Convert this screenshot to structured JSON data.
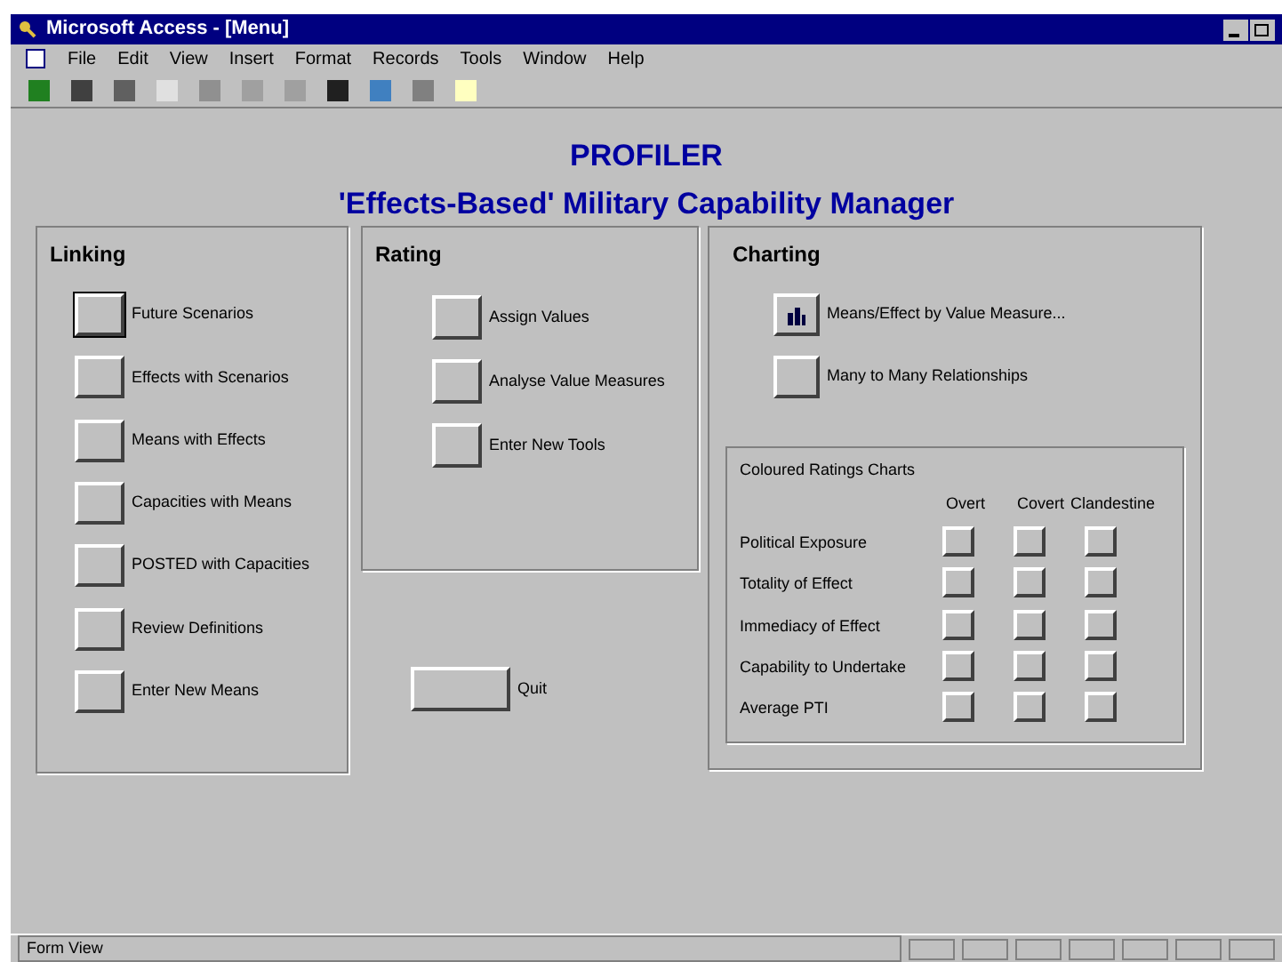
{
  "window": {
    "title": "Microsoft Access - [Menu]"
  },
  "menu": [
    "File",
    "Edit",
    "View",
    "Insert",
    "Format",
    "Records",
    "Tools",
    "Window",
    "Help"
  ],
  "form": {
    "title": "PROFILER",
    "subtitle": "'Effects-Based' Military Capability Manager"
  },
  "linking": {
    "title": "Linking",
    "buttons": [
      {
        "label": "Future Scenarios",
        "focused": true
      },
      {
        "label": "Effects with Scenarios",
        "focused": false
      },
      {
        "label": "Means with Effects",
        "focused": false
      },
      {
        "label": "Capacities with Means",
        "focused": false
      },
      {
        "label": "POSTED with Capacities",
        "focused": false
      },
      {
        "label": "Review Definitions",
        "focused": false
      },
      {
        "label": "Enter New Means",
        "focused": false
      }
    ]
  },
  "rating": {
    "title": "Rating",
    "buttons": [
      {
        "label": "Assign Values"
      },
      {
        "label": "Analyse Value Measures"
      },
      {
        "label": "Enter New Tools"
      }
    ]
  },
  "quit": {
    "label": "Quit"
  },
  "charting": {
    "title": "Charting",
    "buttons": [
      {
        "label": "Means/Effect by Value Measure...",
        "kind": "chart"
      },
      {
        "label": "Many to Many Relationships",
        "kind": "plain"
      }
    ],
    "ratings": {
      "title": "Coloured Ratings Charts",
      "columns": [
        "Overt",
        "Covert",
        "Clandestine"
      ],
      "rows": [
        "Political Exposure",
        "Totality of Effect",
        "Immediacy of Effect",
        "Capability to Undertake",
        "Average PTI"
      ]
    }
  },
  "status_bar": {
    "text": "Form View"
  }
}
